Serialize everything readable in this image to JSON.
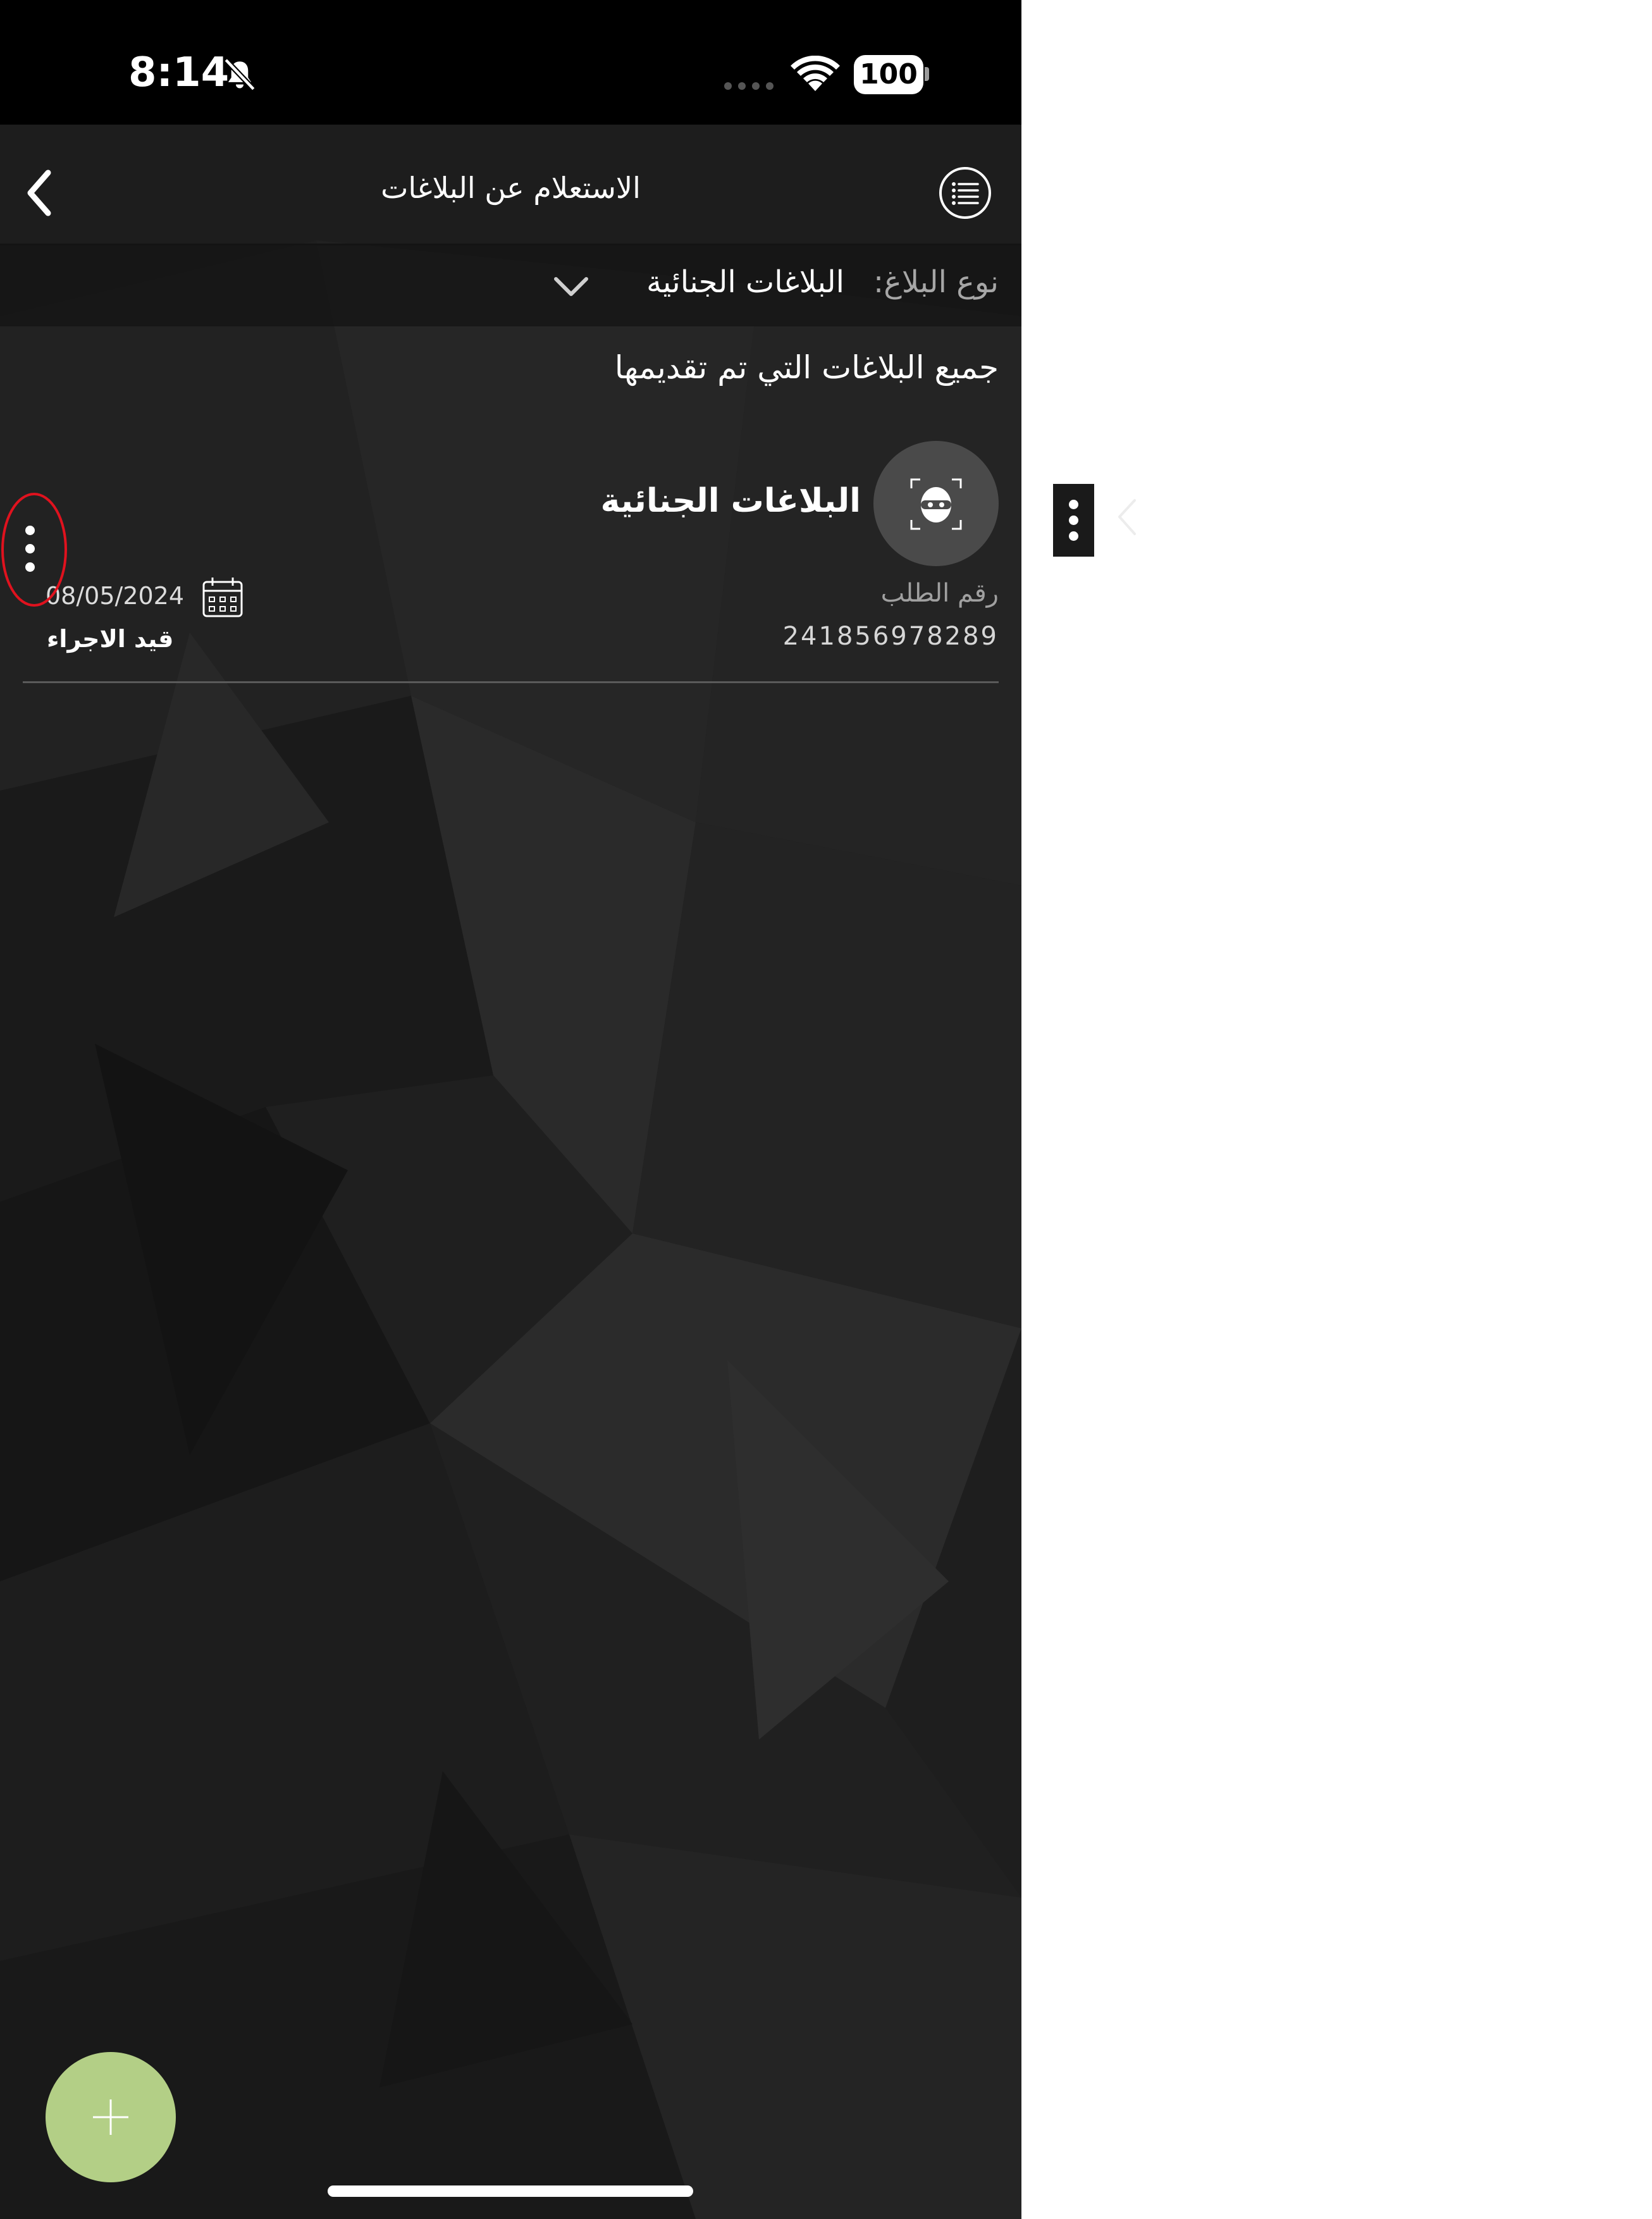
{
  "status_bar": {
    "time": "8:14",
    "battery": "100"
  },
  "header": {
    "title": "الاستعلام عن البلاغات",
    "back_icon": "chevron-left-icon",
    "menu_icon": "list-circle-icon"
  },
  "filter": {
    "label": "نوع البلاغ:",
    "selected_value": "البلاغات الجنائية"
  },
  "section": {
    "heading": "جميع البلاغات التي تم تقديمها"
  },
  "reports": [
    {
      "title": "البلاغات الجنائية",
      "icon": "masked-criminal-icon",
      "request_label": "رقم الطلب",
      "request_number": "241856978289",
      "date": "08/05/2024",
      "status": "قيد الاجراء"
    }
  ],
  "colors": {
    "background": "#1c1c1c",
    "fab": "#b3cf86",
    "highlight": "#e0121e",
    "muted_text": "#a6a6a6"
  }
}
